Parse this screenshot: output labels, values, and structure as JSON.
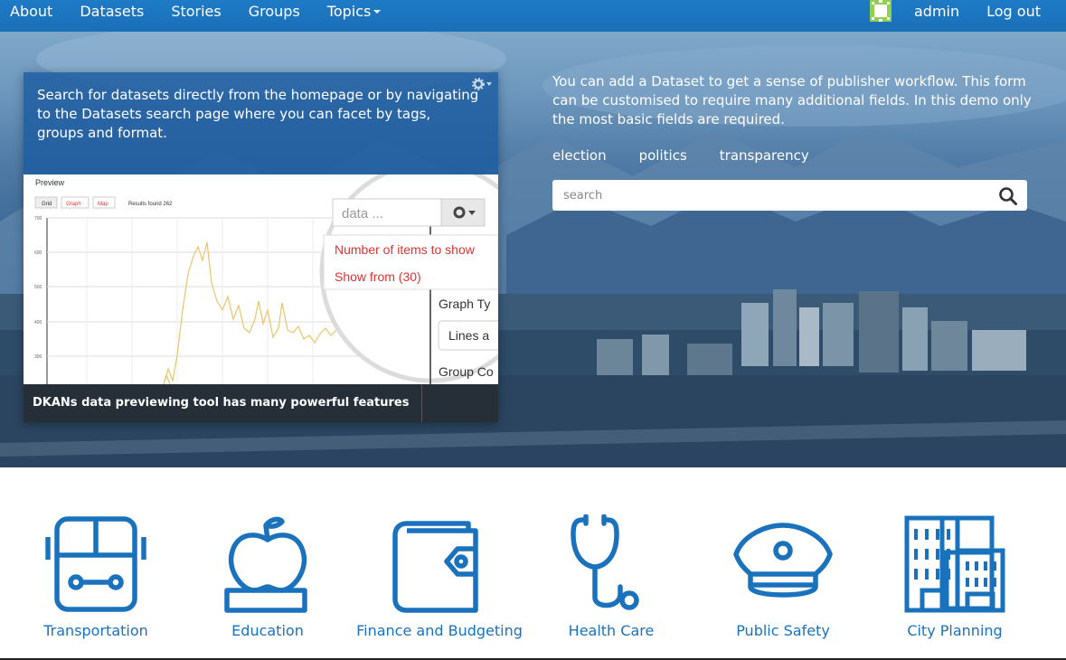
{
  "nav": {
    "left": [
      "About",
      "Datasets",
      "Stories",
      "Groups"
    ],
    "topics_label": "Topics",
    "user_label": "admin",
    "logout_label": "Log out"
  },
  "hero": {
    "card": {
      "description": "Search for datasets directly from the homepage or by navigating to the Datasets search page where you can facet by tags, groups and format.",
      "caption": "DKANs data previewing tool has many powerful features",
      "preview": {
        "title": "Preview",
        "buttons": [
          "Grid",
          "Graph",
          "Map"
        ],
        "results": "Results found 262",
        "search_placeholder": "data ...",
        "menu_items": [
          "Number of items to show",
          "Show from (30)"
        ],
        "graph_type_label": "Graph Ty",
        "graph_type_value": "Lines a",
        "group_label": "Group Co",
        "y_ticks": [
          "700",
          "600",
          "500",
          "400",
          "300"
        ]
      }
    },
    "intro": "You can add a Dataset to get a sense of publisher workflow. This form can be customised to require many additional fields. In this demo only the most basic fields are required.",
    "tags": [
      "election",
      "politics",
      "transparency"
    ],
    "search_placeholder": "search"
  },
  "topics": [
    {
      "label": "Transportation",
      "icon": "bus-icon"
    },
    {
      "label": "Education",
      "icon": "apple-books-icon"
    },
    {
      "label": "Finance and Budgeting",
      "icon": "wallet-icon"
    },
    {
      "label": "Health Care",
      "icon": "stethoscope-icon"
    },
    {
      "label": "Public Safety",
      "icon": "police-hat-icon"
    },
    {
      "label": "City Planning",
      "icon": "buildings-icon"
    }
  ],
  "colors": {
    "brand": "#1a72bd",
    "nav": "#1e7bc7"
  }
}
